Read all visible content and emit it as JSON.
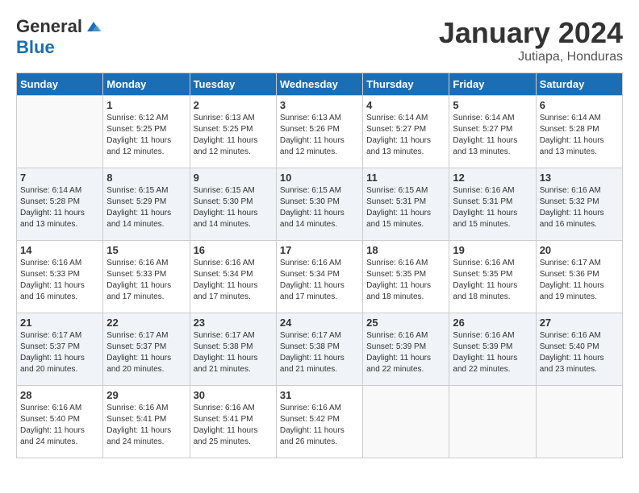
{
  "logo": {
    "general": "General",
    "blue": "Blue"
  },
  "title": {
    "month": "January 2024",
    "location": "Jutiapa, Honduras"
  },
  "weekdays": [
    "Sunday",
    "Monday",
    "Tuesday",
    "Wednesday",
    "Thursday",
    "Friday",
    "Saturday"
  ],
  "weeks": [
    [
      {
        "day": "",
        "info": ""
      },
      {
        "day": "1",
        "info": "Sunrise: 6:12 AM\nSunset: 5:25 PM\nDaylight: 11 hours\nand 12 minutes."
      },
      {
        "day": "2",
        "info": "Sunrise: 6:13 AM\nSunset: 5:25 PM\nDaylight: 11 hours\nand 12 minutes."
      },
      {
        "day": "3",
        "info": "Sunrise: 6:13 AM\nSunset: 5:26 PM\nDaylight: 11 hours\nand 12 minutes."
      },
      {
        "day": "4",
        "info": "Sunrise: 6:14 AM\nSunset: 5:27 PM\nDaylight: 11 hours\nand 13 minutes."
      },
      {
        "day": "5",
        "info": "Sunrise: 6:14 AM\nSunset: 5:27 PM\nDaylight: 11 hours\nand 13 minutes."
      },
      {
        "day": "6",
        "info": "Sunrise: 6:14 AM\nSunset: 5:28 PM\nDaylight: 11 hours\nand 13 minutes."
      }
    ],
    [
      {
        "day": "7",
        "info": "Sunrise: 6:14 AM\nSunset: 5:28 PM\nDaylight: 11 hours\nand 13 minutes."
      },
      {
        "day": "8",
        "info": "Sunrise: 6:15 AM\nSunset: 5:29 PM\nDaylight: 11 hours\nand 14 minutes."
      },
      {
        "day": "9",
        "info": "Sunrise: 6:15 AM\nSunset: 5:30 PM\nDaylight: 11 hours\nand 14 minutes."
      },
      {
        "day": "10",
        "info": "Sunrise: 6:15 AM\nSunset: 5:30 PM\nDaylight: 11 hours\nand 14 minutes."
      },
      {
        "day": "11",
        "info": "Sunrise: 6:15 AM\nSunset: 5:31 PM\nDaylight: 11 hours\nand 15 minutes."
      },
      {
        "day": "12",
        "info": "Sunrise: 6:16 AM\nSunset: 5:31 PM\nDaylight: 11 hours\nand 15 minutes."
      },
      {
        "day": "13",
        "info": "Sunrise: 6:16 AM\nSunset: 5:32 PM\nDaylight: 11 hours\nand 16 minutes."
      }
    ],
    [
      {
        "day": "14",
        "info": "Sunrise: 6:16 AM\nSunset: 5:33 PM\nDaylight: 11 hours\nand 16 minutes."
      },
      {
        "day": "15",
        "info": "Sunrise: 6:16 AM\nSunset: 5:33 PM\nDaylight: 11 hours\nand 17 minutes."
      },
      {
        "day": "16",
        "info": "Sunrise: 6:16 AM\nSunset: 5:34 PM\nDaylight: 11 hours\nand 17 minutes."
      },
      {
        "day": "17",
        "info": "Sunrise: 6:16 AM\nSunset: 5:34 PM\nDaylight: 11 hours\nand 17 minutes."
      },
      {
        "day": "18",
        "info": "Sunrise: 6:16 AM\nSunset: 5:35 PM\nDaylight: 11 hours\nand 18 minutes."
      },
      {
        "day": "19",
        "info": "Sunrise: 6:16 AM\nSunset: 5:35 PM\nDaylight: 11 hours\nand 18 minutes."
      },
      {
        "day": "20",
        "info": "Sunrise: 6:17 AM\nSunset: 5:36 PM\nDaylight: 11 hours\nand 19 minutes."
      }
    ],
    [
      {
        "day": "21",
        "info": "Sunrise: 6:17 AM\nSunset: 5:37 PM\nDaylight: 11 hours\nand 20 minutes."
      },
      {
        "day": "22",
        "info": "Sunrise: 6:17 AM\nSunset: 5:37 PM\nDaylight: 11 hours\nand 20 minutes."
      },
      {
        "day": "23",
        "info": "Sunrise: 6:17 AM\nSunset: 5:38 PM\nDaylight: 11 hours\nand 21 minutes."
      },
      {
        "day": "24",
        "info": "Sunrise: 6:17 AM\nSunset: 5:38 PM\nDaylight: 11 hours\nand 21 minutes."
      },
      {
        "day": "25",
        "info": "Sunrise: 6:16 AM\nSunset: 5:39 PM\nDaylight: 11 hours\nand 22 minutes."
      },
      {
        "day": "26",
        "info": "Sunrise: 6:16 AM\nSunset: 5:39 PM\nDaylight: 11 hours\nand 22 minutes."
      },
      {
        "day": "27",
        "info": "Sunrise: 6:16 AM\nSunset: 5:40 PM\nDaylight: 11 hours\nand 23 minutes."
      }
    ],
    [
      {
        "day": "28",
        "info": "Sunrise: 6:16 AM\nSunset: 5:40 PM\nDaylight: 11 hours\nand 24 minutes."
      },
      {
        "day": "29",
        "info": "Sunrise: 6:16 AM\nSunset: 5:41 PM\nDaylight: 11 hours\nand 24 minutes."
      },
      {
        "day": "30",
        "info": "Sunrise: 6:16 AM\nSunset: 5:41 PM\nDaylight: 11 hours\nand 25 minutes."
      },
      {
        "day": "31",
        "info": "Sunrise: 6:16 AM\nSunset: 5:42 PM\nDaylight: 11 hours\nand 26 minutes."
      },
      {
        "day": "",
        "info": ""
      },
      {
        "day": "",
        "info": ""
      },
      {
        "day": "",
        "info": ""
      }
    ]
  ]
}
